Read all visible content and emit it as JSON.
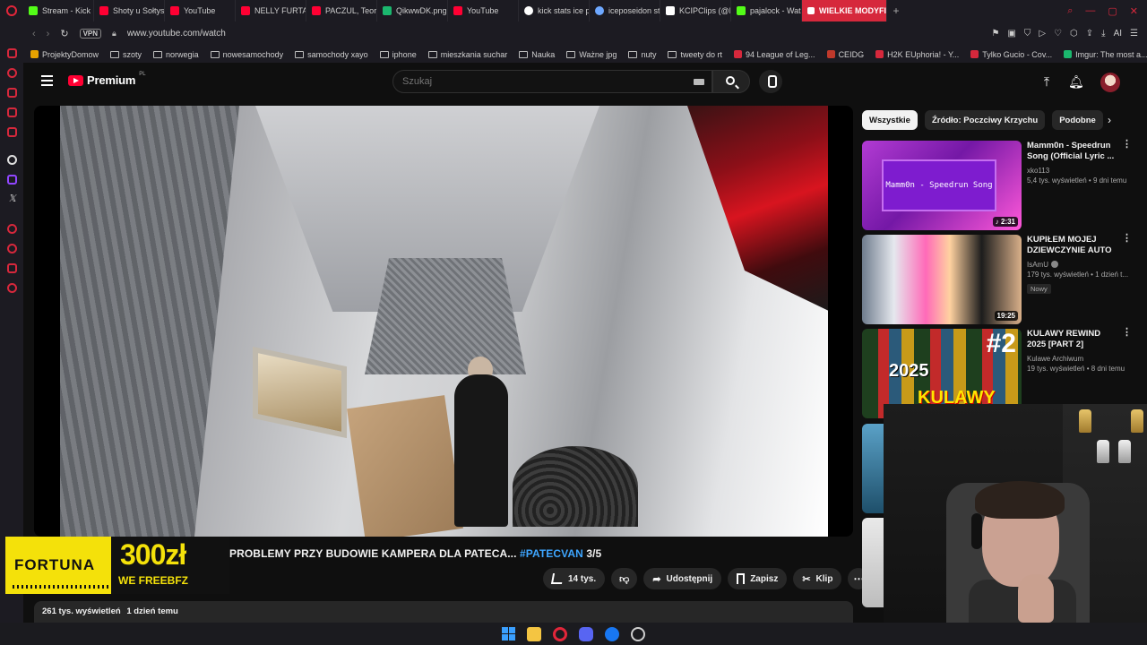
{
  "browser": {
    "tabs": [
      {
        "label": "Stream - Kick De",
        "color": "#53fc18"
      },
      {
        "label": "Shoty u Sołtysa",
        "color": "#ff0033"
      },
      {
        "label": "YouTube",
        "color": "#ff0033"
      },
      {
        "label": "NELLY FURTADO",
        "color": "#ff0033"
      },
      {
        "label": "PACZUL, Teorie",
        "color": "#ff0033"
      },
      {
        "label": "QikwwDK.png (",
        "color": "#1bb76e"
      },
      {
        "label": "YouTube",
        "color": "#ff0033"
      },
      {
        "label": "kick stats ice po",
        "color": "#ffffff"
      },
      {
        "label": "iceposeidon stre",
        "color": "#6ea8ff"
      },
      {
        "label": "KCIPClips (@KC",
        "color": "#ffffff"
      },
      {
        "label": "pajalock - Watc",
        "color": "#53fc18"
      },
      {
        "label": "WIELKIE MODYFIKAC",
        "color": "#ffffff"
      }
    ],
    "new_tab": "+",
    "url": "www.youtube.com/watch",
    "vpn_label": "VPN",
    "ai_label": "AI",
    "bookmarks": [
      {
        "label": "ProjektyDomow",
        "type": "fav",
        "color": "#e6a200"
      },
      {
        "label": "szoty",
        "type": "folder"
      },
      {
        "label": "norwegia",
        "type": "folder"
      },
      {
        "label": "nowesamochody",
        "type": "folder"
      },
      {
        "label": "samochody xayo",
        "type": "folder"
      },
      {
        "label": "iphone",
        "type": "folder"
      },
      {
        "label": "mieszkania suchar",
        "type": "folder"
      },
      {
        "label": "Nauka",
        "type": "folder"
      },
      {
        "label": "Ważne jpg",
        "type": "folder"
      },
      {
        "label": "nuty",
        "type": "folder"
      },
      {
        "label": "tweety do rt",
        "type": "folder"
      },
      {
        "label": "94 League of Leg...",
        "type": "fav",
        "color": "#d6283c"
      },
      {
        "label": "CEIDG",
        "type": "fav",
        "color": "#c0392b"
      },
      {
        "label": "H2K EUphoria! - Y...",
        "type": "fav",
        "color": "#d6283c"
      },
      {
        "label": "Tylko Gucio - Cov...",
        "type": "fav",
        "color": "#d6283c"
      },
      {
        "label": "Imgur: The most a...",
        "type": "fav",
        "color": "#1bb76e"
      }
    ]
  },
  "youtube": {
    "logo_text": "Premium",
    "region": "PL",
    "search_placeholder": "Szukaj",
    "video": {
      "title_main": "PROBLEMY PRZY BUDOWIE KAMPERA DLA PATECA...",
      "hashtag": "#PATECVAN",
      "title_suffix": "3/5",
      "likes": "14 tys.",
      "share_label": "Udostępnij",
      "save_label": "Zapisz",
      "clip_label": "Klip",
      "views": "261 tys. wyświetleń",
      "age": "1 dzień temu"
    },
    "ad": {
      "brand": "FORTUNA",
      "amount": "300zł",
      "promo": "WE FREEBFZ"
    },
    "chips": [
      "Wszystkie",
      "Źródło: Poczciwy Krzychu",
      "Podobne"
    ],
    "recommendations": [
      {
        "title": "Mamm0n - Speedrun Song (Official Lyric ...",
        "channel": "xko113",
        "meta": "5,4 tys. wyświetleń • 9 dni temu",
        "duration": "♪ 2:31",
        "thumb_text": "Mamm0n - Speedrun Song"
      },
      {
        "title": "KUPIŁEM MOJEJ DZIEWCZYNIE AUTO ...",
        "channel": "IsAmU",
        "meta": "179 tys. wyświetleń • 1 dzień t...",
        "badge": "Nowy",
        "duration": "19:25"
      },
      {
        "title": "KULAWY REWIND 2025 [PART 2]",
        "channel": "Kulawe Archiwum",
        "meta": "19 tys. wyświetleń • 8 dni temu",
        "thumb_big": "#2",
        "thumb_year": "2025",
        "thumb_name": "KULAWY"
      }
    ]
  }
}
